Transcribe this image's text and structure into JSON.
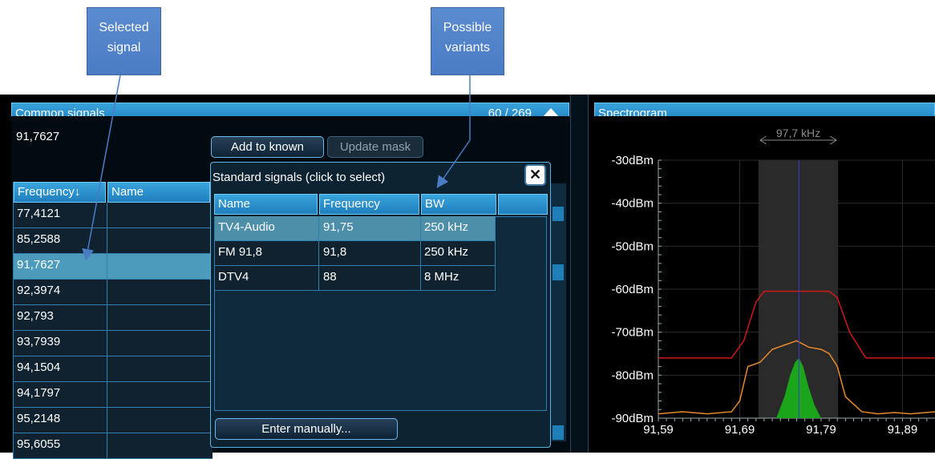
{
  "callouts": {
    "selected": [
      "Selected",
      "signal"
    ],
    "variants": [
      "Possible",
      "variants"
    ]
  },
  "left_panel": {
    "title": "Common signals",
    "count": "60 / 269",
    "selected_value": "91,7627",
    "add_button": "Add to known",
    "update_button": "Update mask",
    "columns": [
      "Frequency",
      "Name"
    ],
    "rows": [
      "77,4121",
      "85,2588",
      "91,7627",
      "92,3974",
      "92,793",
      "93,7939",
      "94,1504",
      "94,1797",
      "95,2148",
      "95,6055"
    ],
    "selected_row": 2
  },
  "popup": {
    "title": "Standard signals (click to select)",
    "close_icon": "close-icon",
    "columns": [
      "Name",
      "Frequency",
      "BW"
    ],
    "rows": [
      {
        "name": "TV4-Audio",
        "frequency": "91,75",
        "bw": "250 kHz"
      },
      {
        "name": "FM 91,8",
        "frequency": "91,8",
        "bw": "250 kHz"
      },
      {
        "name": "DTV4",
        "frequency": "88",
        "bw": "8 MHz"
      }
    ],
    "selected_row": 0,
    "manual_button": "Enter manually..."
  },
  "spectrogram": {
    "title": "Spectrogram",
    "bandwidth_label": "97,7 kHz"
  },
  "chart_data": {
    "type": "line",
    "ylim": [
      -90,
      -30
    ],
    "y_ticks": [
      "-30dBm",
      "-40dBm",
      "-50dBm",
      "-60dBm",
      "-70dBm",
      "-80dBm",
      "-90dBm"
    ],
    "y_tick_values": [
      -30,
      -40,
      -50,
      -60,
      -70,
      -80,
      -90
    ],
    "x_ticks": [
      "91,59",
      "91,69",
      "91,79",
      "91,89"
    ],
    "x_tick_values": [
      91.59,
      91.69,
      91.79,
      91.89
    ],
    "xlim": [
      91.59,
      91.93
    ],
    "marker_x": 91.7627,
    "band": [
      91.713,
      91.811
    ],
    "series": [
      {
        "color": "#d01818",
        "x": [
          91.59,
          91.64,
          91.68,
          91.695,
          91.71,
          91.72,
          91.8,
          91.81,
          91.825,
          91.845,
          91.86,
          91.93
        ],
        "values": [
          -76,
          -76,
          -76,
          -72,
          -63,
          -60.5,
          -60.5,
          -62,
          -70,
          -76,
          -76,
          -76
        ]
      },
      {
        "color": "#e8892a",
        "x": [
          91.59,
          91.62,
          91.65,
          91.68,
          91.69,
          91.7,
          91.715,
          91.73,
          91.745,
          91.76,
          91.775,
          91.79,
          91.8,
          91.81,
          91.82,
          91.84,
          91.86,
          91.88,
          91.9,
          91.93
        ],
        "values": [
          -89,
          -88.5,
          -89,
          -88.5,
          -86,
          -78,
          -77,
          -74,
          -73,
          -72,
          -73.5,
          -74,
          -75,
          -78,
          -85,
          -88.5,
          -89,
          -88.7,
          -89,
          -88.5
        ]
      },
      {
        "color": "#1aa51a",
        "x": [
          91.735,
          91.745,
          91.752,
          91.758,
          91.7627,
          91.768,
          91.775,
          91.782,
          91.79
        ],
        "values": [
          -90,
          -85,
          -80,
          -77,
          -76,
          -78,
          -83,
          -87,
          -90
        ]
      }
    ]
  }
}
